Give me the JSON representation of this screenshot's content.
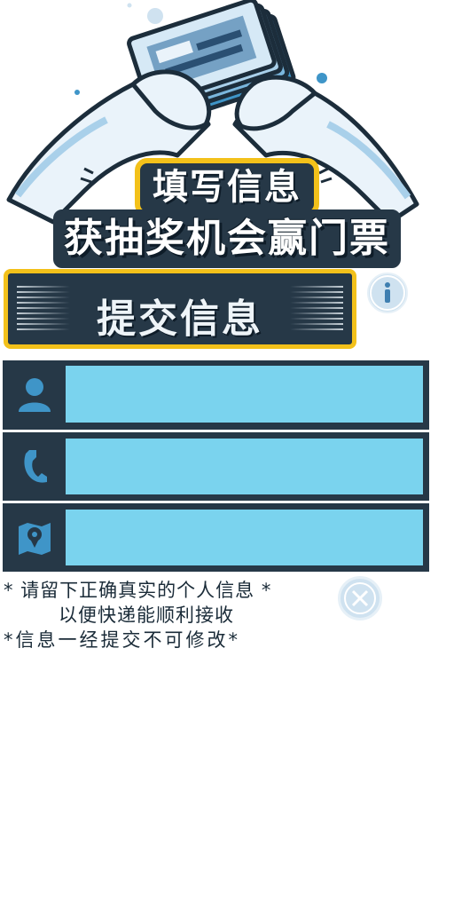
{
  "header": {
    "title_line1": "填写信息",
    "title_line2": "获抽奖机会赢门票"
  },
  "submit_button": {
    "label": "提交信息"
  },
  "info_button": {
    "icon": "info-icon"
  },
  "form": {
    "fields": [
      {
        "name": "name",
        "icon": "person-icon",
        "value": "",
        "placeholder": ""
      },
      {
        "name": "phone",
        "icon": "phone-icon",
        "value": "",
        "placeholder": ""
      },
      {
        "name": "address",
        "icon": "map-pin-icon",
        "value": "",
        "placeholder": ""
      }
    ]
  },
  "notes": {
    "line1": "* 请留下正确真实的个人信息 *",
    "line2": "以便快递能顺利接收",
    "line3": "*信息一经提交不可修改*"
  },
  "close_button": {
    "icon": "close-icon"
  },
  "colors": {
    "panel_dark": "#263847",
    "accent_yellow": "#f3c11a",
    "field_blue": "#7ad3ee",
    "icon_blue": "#3f95c8",
    "bubble_light": "#cfe2f0"
  }
}
